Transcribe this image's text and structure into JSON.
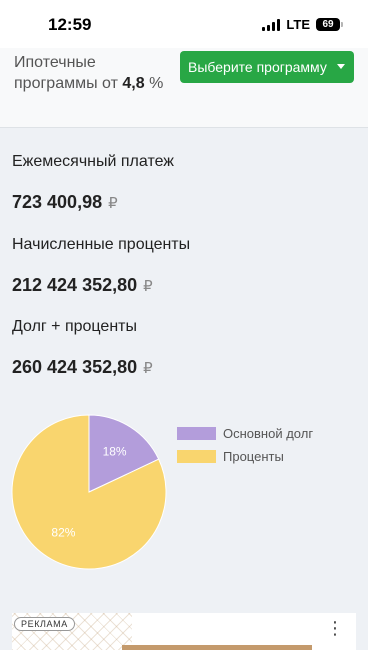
{
  "status_bar": {
    "time": "12:59",
    "network": "LTE",
    "battery": "69"
  },
  "header": {
    "mortgage_prefix": "Ипотечные программы от",
    "mortgage_rate": "4,8",
    "mortgage_suffix": "%",
    "program_button_label": "Выберите программу"
  },
  "results": {
    "monthly_payment_label": "Ежемесячный платеж",
    "monthly_payment_value": "723 400,98",
    "accrued_interest_label": "Начисленные проценты",
    "accrued_interest_value": "212 424 352,80",
    "total_label": "Долг + проценты",
    "total_value": "260 424 352,80",
    "currency": "₽"
  },
  "chart_data": {
    "type": "pie",
    "slices": [
      {
        "label": "Основной долг",
        "value": 18,
        "display": "18%",
        "color": "#b39ddb"
      },
      {
        "label": "Проценты",
        "value": 82,
        "display": "82%",
        "color": "#f9d56e"
      }
    ],
    "legend_position": "right"
  },
  "ad": {
    "badge": "РЕКЛАМА",
    "menu_icon": "more-vertical-icon"
  }
}
